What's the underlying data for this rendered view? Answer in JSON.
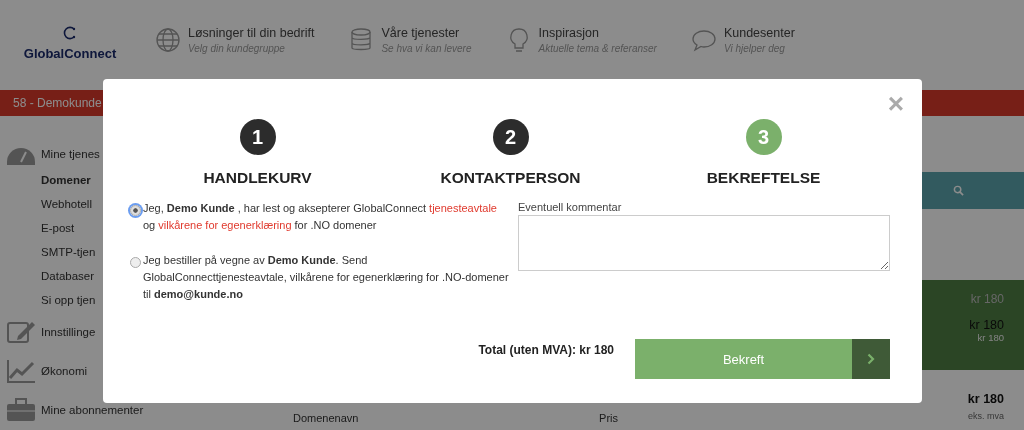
{
  "header": {
    "logo": "GlobalConnect",
    "nav": [
      {
        "title": "Løsninger til din bedrift",
        "subtitle": "Velg din kundegruppe"
      },
      {
        "title": "Våre tjenester",
        "subtitle": "Se hva vi kan levere"
      },
      {
        "title": "Inspirasjon",
        "subtitle": "Aktuelle tema & referanser"
      },
      {
        "title": "Kundesenter",
        "subtitle": "Vi hjelper deg"
      }
    ]
  },
  "account_bar": {
    "label": "58 - Demokunde"
  },
  "sidebar": {
    "items": [
      {
        "label": "Mine tjenes",
        "kind": "section",
        "selected": false
      },
      {
        "label": "Domener",
        "kind": "item",
        "selected": true
      },
      {
        "label": "Webhotell",
        "kind": "item",
        "selected": false
      },
      {
        "label": "E-post",
        "kind": "item",
        "selected": false
      },
      {
        "label": "SMTP-tjen",
        "kind": "item",
        "selected": false
      },
      {
        "label": "Databaser",
        "kind": "item",
        "selected": false
      },
      {
        "label": "Si opp tjen",
        "kind": "item",
        "selected": false
      },
      {
        "label": "Innstillinge",
        "kind": "section",
        "selected": false
      },
      {
        "label": "Økonomi",
        "kind": "section",
        "selected": false
      },
      {
        "label": "Mine abonnementer",
        "kind": "section",
        "selected": false
      }
    ]
  },
  "summary": {
    "lines": [
      {
        "amount": "kr 180",
        "kind": "muted"
      },
      {
        "amount": "kr 180",
        "kind": "strong",
        "note": "kr 180"
      }
    ],
    "total": {
      "amount": "kr 180",
      "note": "eks. mva"
    }
  },
  "table": {
    "columns": [
      "Domenenavn",
      "Pris"
    ]
  },
  "modal": {
    "close": "×",
    "steps": [
      {
        "number": "1",
        "label": "HANDLEKURV",
        "selected": false
      },
      {
        "number": "2",
        "label": "KONTAKTPERSON",
        "selected": false
      },
      {
        "number": "3",
        "label": "BEKREFTELSE",
        "selected": true
      }
    ],
    "options": [
      {
        "selected": true,
        "segments": [
          {
            "kind": "text",
            "text": "Jeg, **Demo Kunde** , har lest og aksepterer GlobalConnect"
          },
          {
            "kind": "link",
            "text": "tjenesteavtale"
          },
          {
            "kind": "text",
            "text": "og"
          },
          {
            "kind": "link",
            "text": "vilkårene for egenerklæring"
          },
          {
            "kind": "text",
            "text": "for .NO domener"
          }
        ]
      },
      {
        "selected": false,
        "segments": [
          {
            "kind": "text",
            "text": "Jeg bestiller på vegne av **Demo Kunde**. Send GlobalConnecttjenesteavtale, vilkårene for egenerklæring for .NO-domener til **demo@kunde.no**"
          }
        ]
      }
    ],
    "comment": {
      "label": "Eventuell kommentar"
    },
    "total": "Total (uten MVA): kr 180",
    "confirm": "Bekreft"
  }
}
